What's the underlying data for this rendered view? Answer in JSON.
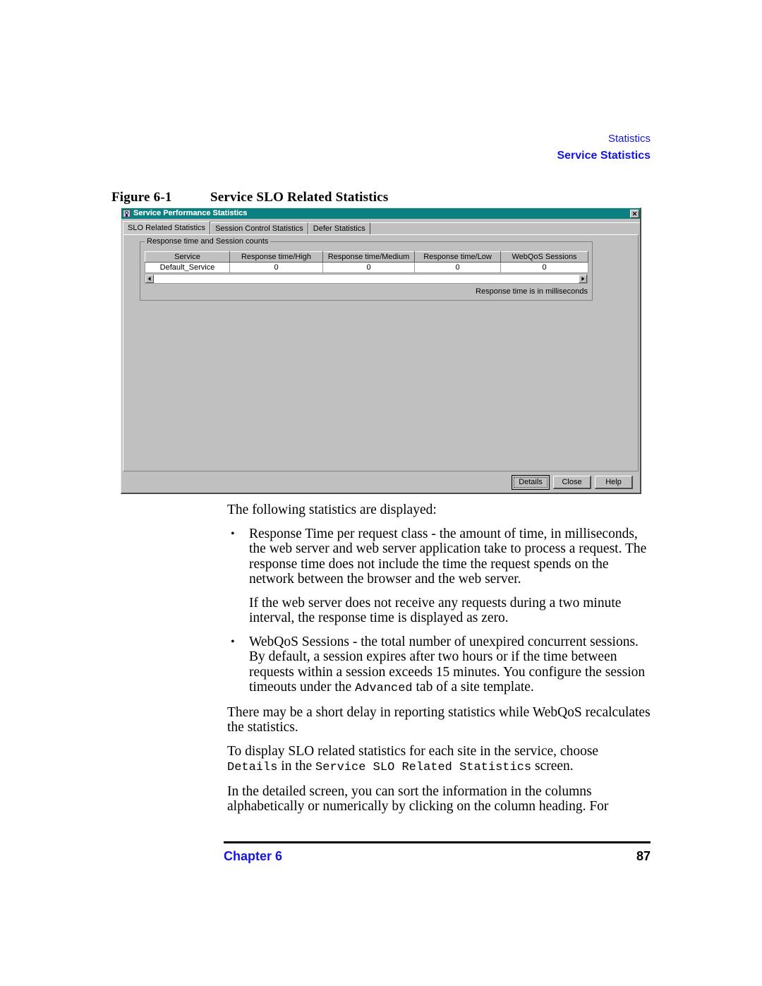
{
  "running_head": {
    "line1": "Statistics",
    "line2": "Service Statistics",
    "color": "#1414e6"
  },
  "figure": {
    "number": "Figure 6-1",
    "title": "Service SLO Related Statistics"
  },
  "dialog": {
    "title": "Service Performance Statistics",
    "title_icon": "app-icon",
    "titlebar_color": "#0b8080",
    "close_label": "✕",
    "tabs": [
      {
        "label": "SLO Related Statistics",
        "active": true
      },
      {
        "label": "Session Control Statistics",
        "active": false
      },
      {
        "label": "Defer Statistics",
        "active": false
      }
    ],
    "groupbox": {
      "legend": "Response time and Session counts",
      "table": {
        "columns": [
          "Service",
          "Response time/High",
          "Response time/Medium",
          "Response time/Low",
          "WebQoS Sessions"
        ],
        "rows": [
          [
            "Default_Service",
            "0",
            "0",
            "0",
            "0"
          ]
        ]
      },
      "scrollbar": {
        "left_arrow": "scroll-left-arrow",
        "right_arrow": "scroll-right-arrow"
      },
      "units_note": "Response time is in milliseconds"
    },
    "buttons": [
      {
        "label": "Details",
        "default": true
      },
      {
        "label": "Close",
        "default": false
      },
      {
        "label": "Help",
        "default": false
      }
    ]
  },
  "body": {
    "intro": "The following statistics are displayed:",
    "bullet1_part1": "Response Time per request class - the amount of time, in milliseconds, the web server and web server application take to process a request. The response time does not include the time the request spends on the network between the browser and the web server.",
    "bullet1_note": "If the web server does not receive any requests during a two minute interval, the response time is displayed as zero.",
    "bullet2_a": "WebQoS Sessions - the total number of unexpired concurrent sessions. By default, a session expires after two hours or if the time between requests within a session exceeds 15 minutes. You configure the session timeouts under the ",
    "bullet2_mono": "Advanced",
    "bullet2_b": " tab of a site template.",
    "para_delay": "There may be a short delay in reporting statistics while WebQoS recalculates the statistics.",
    "para_details_a": "To display SLO related statistics for each site in the service, choose ",
    "para_details_mono1": "Details",
    "para_details_b": " in the ",
    "para_details_mono2": "Service SLO Related Statistics",
    "para_details_c": " screen.",
    "para_sort": "In the detailed screen, you can sort the information in the columns alphabetically or numerically by clicking on the column heading. For",
    "bullet_glyph": "•"
  },
  "footer": {
    "chapter": "Chapter 6",
    "page": "87"
  }
}
